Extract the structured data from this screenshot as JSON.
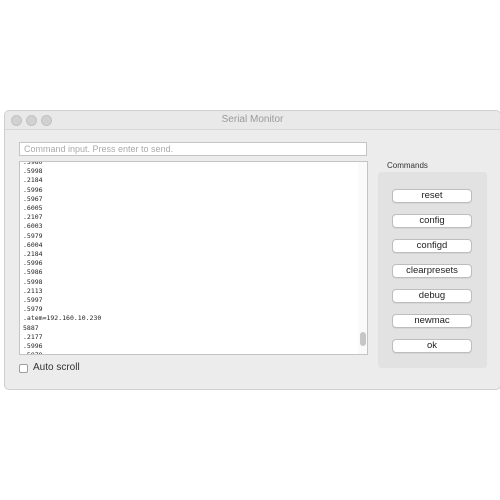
{
  "window": {
    "title": "Serial Monitor"
  },
  "command_input": {
    "placeholder": "Command input. Press enter to send.",
    "value": ""
  },
  "output_lines": [
    ".5980",
    ".5998",
    ".2184",
    ".5996",
    ".5967",
    ".6005",
    ".2107",
    ".6003",
    ".5979",
    ".6004",
    ".2184",
    ".5996",
    ".5986",
    ".5998",
    ".2113",
    ".5997",
    ".5979",
    ".atem=192.160.10.230",
    "5887",
    ".2177",
    ".5996",
    ".5979"
  ],
  "auto_scroll": {
    "label": "Auto scroll",
    "checked": false
  },
  "commands": {
    "label": "Commands",
    "buttons": [
      "reset",
      "config",
      "configd",
      "clearpresets",
      "debug",
      "newmac",
      "ok"
    ]
  }
}
